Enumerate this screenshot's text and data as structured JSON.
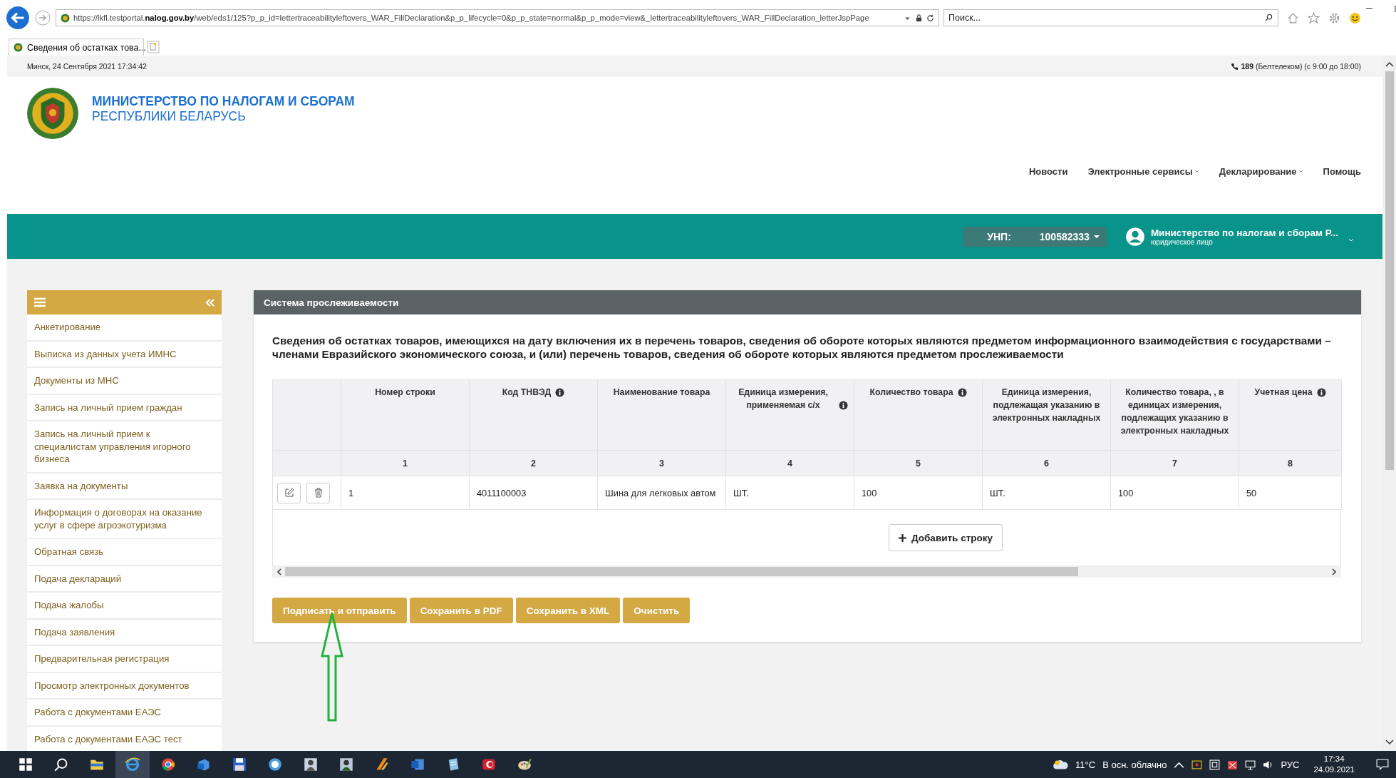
{
  "browser": {
    "url": "https://lkfl.testportal.**nalog.gov.by**/web/eds1/125?p_p_id=lettertraceabilityleftovers_WAR_FillDeclaration&p_p_lifecycle=0&p_p_state=normal&p_p_mode=view&_lettertraceabilityleftovers_WAR_FillDeclaration_letterJspPage",
    "search_placeholder": "Поиск...",
    "tab_title": "Сведения об остатках това..."
  },
  "top_strip": {
    "date": "Минск, 24 Сентября 2021 17:34:42",
    "phone": "**189** (Белтелеком) (с 9:00 до 18:00)"
  },
  "header": {
    "org_line1": "МИНИСТЕРСТВО ПО НАЛОГАМ И СБОРАМ",
    "org_line2": "РЕСПУБЛИКИ БЕЛАРУСЬ",
    "nav": [
      {
        "label": "Новости",
        "dropdown": false
      },
      {
        "label": "Электронные сервисы",
        "dropdown": true
      },
      {
        "label": "Декларирование",
        "dropdown": true
      },
      {
        "label": "Помощь",
        "dropdown": false
      }
    ]
  },
  "account": {
    "unp_label": "УНП:",
    "unp": "100582333",
    "user_name": "Министерство по налогам и сборам Р...",
    "user_type": "юридическое лицо"
  },
  "sidebar": {
    "items": [
      "Анкетирование",
      "Выписка из данных учета ИМНС",
      "Документы из МНС",
      "Запись на личный прием граждан",
      "Запись на личный прием к специалистам управления игорного бизнеса",
      "Заявка на документы",
      "Информация о договорах на оказание услуг в сфере агроэкотуризма",
      "Обратная связь",
      "Подача деклараций",
      "Подача жалобы",
      "Подача заявления",
      "Предварительная регистрация",
      "Просмотр электронных документов",
      "Работа с документами ЕАЭС",
      "Работа с документами ЕАЭС тест"
    ]
  },
  "panel": {
    "title": "Система прослеживаемости",
    "heading": "Сведения об остатках товаров, имеющихся на дату включения их в перечень товаров, сведения об обороте которых являются предметом информационного взаимодействия с государствами – членами Евразийского экономического союза, и (или) перечень товаров, сведения об обороте которых являются предметом прослеживаемости",
    "table": {
      "columns": [
        {
          "label": "Номер строки",
          "number": "1",
          "info": false
        },
        {
          "label": "Код ТНВЭД",
          "number": "2",
          "info": true
        },
        {
          "label": "Наименование товара",
          "number": "3",
          "info": false
        },
        {
          "label": "Единица измерения, применяемая с/х",
          "number": "4",
          "info": true
        },
        {
          "label": "Количество товара",
          "number": "5",
          "info": true
        },
        {
          "label": "Единица измерения, подлежащая указанию в электронных накладных",
          "number": "6",
          "info": false
        },
        {
          "label": "Количество товара, , в единицах измерения, подлежащих указанию в электронных накладных",
          "number": "7",
          "info": false
        },
        {
          "label": "Учетная цена",
          "number": "8",
          "info": true
        }
      ],
      "rows": [
        {
          "cells": [
            "1",
            "4011100003",
            "Шина для легковых автом",
            "ШТ.",
            "100",
            "ШТ.",
            "100",
            "50"
          ]
        }
      ],
      "add_row_button": "Добавить строку"
    },
    "buttons": [
      "Подписать и отправить",
      "Сохранить в PDF",
      "Сохранить в XML",
      "Очистить"
    ]
  },
  "taskbar": {
    "temperature": "11°C",
    "weather": "В осн. облачно",
    "language": "РУС",
    "time": "17:34",
    "date": "24.09.2021"
  }
}
